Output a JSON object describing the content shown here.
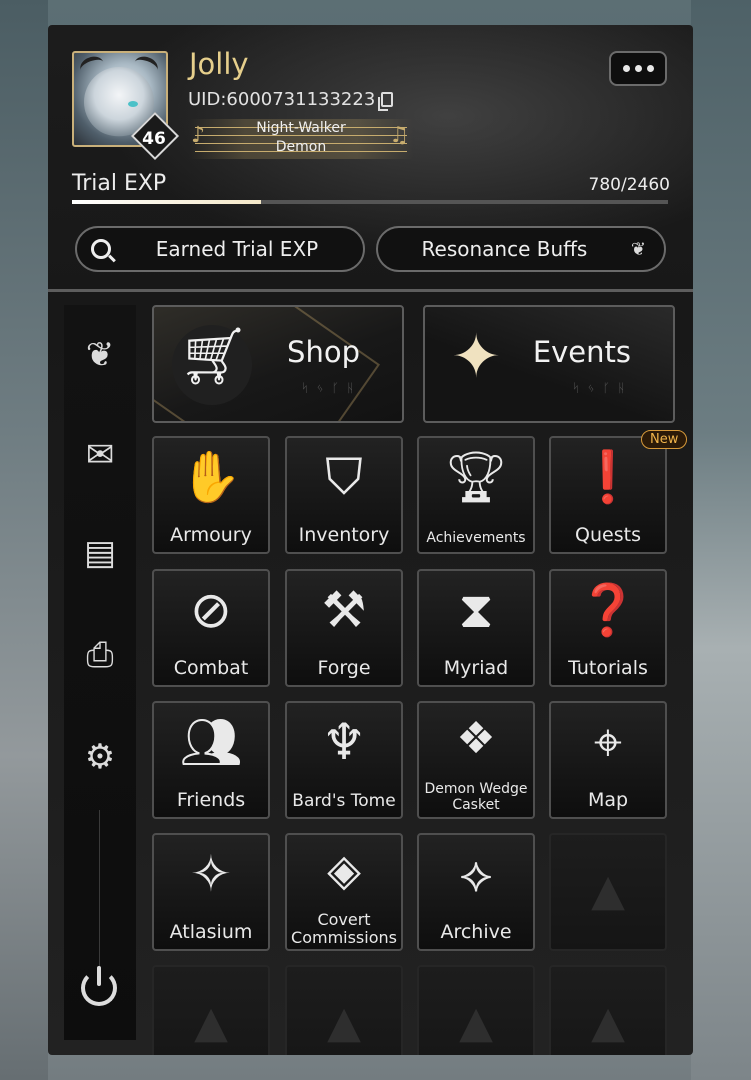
{
  "player": {
    "name": "Jolly",
    "uid": "UID:6000731133223",
    "level": "46",
    "title_line1": "Night-Walker",
    "title_line2": "Demon"
  },
  "trial_exp": {
    "label": "Trial EXP",
    "value": "780/2460",
    "progress_fraction": 0.317
  },
  "buttons": {
    "earned_trial_exp": "Earned Trial EXP",
    "resonance_buffs": "Resonance Buffs"
  },
  "sidebar": {
    "icons": [
      "lotus-icon",
      "mail-icon",
      "badge-icon",
      "camera-icon",
      "gear-icon",
      "power-icon"
    ]
  },
  "features": {
    "shop": "Shop",
    "shop_runes": "ᛋᛃᚴᚺ",
    "events": "Events",
    "events_runes": "ᛋᛃᚴᚺ"
  },
  "menu": {
    "armoury": "Armoury",
    "inventory": "Inventory",
    "achievements": "Achievements",
    "quests": "Quests",
    "new_badge": "New",
    "combat": "Combat",
    "forge": "Forge",
    "myriad": "Myriad",
    "tutorials": "Tutorials",
    "friends": "Friends",
    "bards_tome": "Bard's Tome",
    "demon_wedge_casket": "Demon Wedge Casket",
    "map": "Map",
    "atlasium": "Atlasium",
    "covert_commissions": "Covert Commissions",
    "archive": "Archive"
  },
  "colors": {
    "name_gold": "#e6cf8c",
    "panel_bg": "#181818",
    "new_badge": "#f0b44a"
  }
}
